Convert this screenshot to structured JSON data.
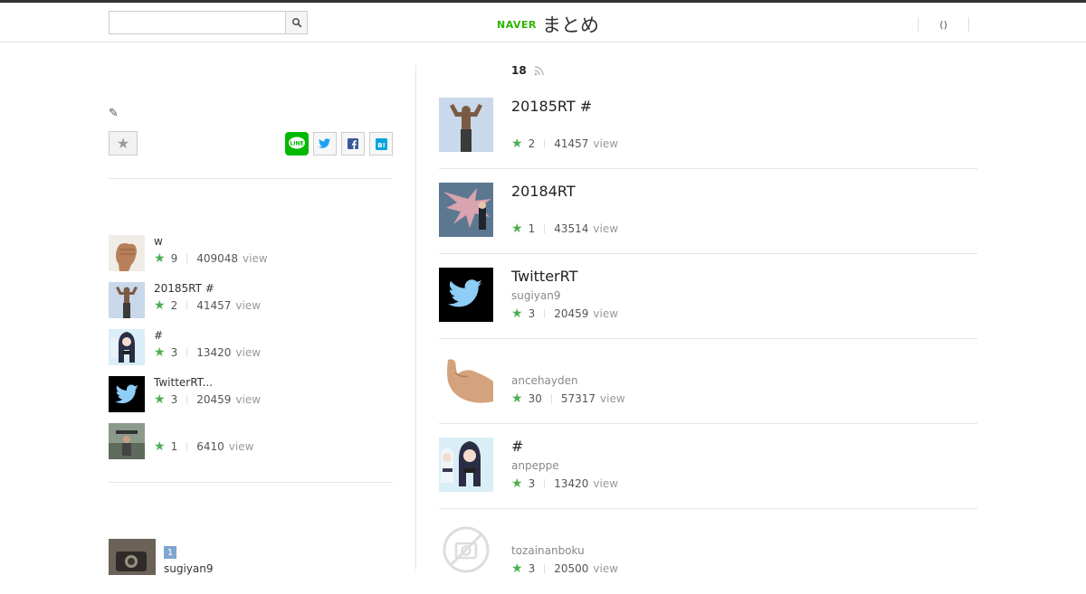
{
  "header": {
    "search": {
      "placeholder": ""
    },
    "logo": {
      "brand": "NAVER",
      "service": "まとめ"
    },
    "right_label": "()"
  },
  "left": {
    "edit_icon": "pencil-icon",
    "favorite_icon": "star-icon",
    "share": {
      "line_label": "LINE",
      "twitter_icon": "twitter-icon",
      "facebook_icon": "facebook-icon",
      "hatena_label": "B!"
    },
    "popular": [
      {
        "title": "w",
        "stars": "9",
        "views": "409048",
        "view_label": "view"
      },
      {
        "title": "20185RT #",
        "stars": "2",
        "views": "41457",
        "view_label": "view"
      },
      {
        "title": "#",
        "stars": "3",
        "views": "13420",
        "view_label": "view"
      },
      {
        "title": "TwitterRT...",
        "stars": "3",
        "views": "20459",
        "view_label": "view"
      },
      {
        "title": "",
        "stars": "1",
        "views": "6410",
        "view_label": "view"
      }
    ],
    "author": {
      "rank": "1",
      "name": "sugiyan9"
    }
  },
  "main": {
    "count": "18",
    "rss_icon": "rss-icon",
    "items": [
      {
        "title": "20185RT #",
        "author": "",
        "stars": "2",
        "views": "41457",
        "view_label": "view"
      },
      {
        "title": "20184RT",
        "author": "",
        "stars": "1",
        "views": "43514",
        "view_label": "view"
      },
      {
        "title": "TwitterRT",
        "author": "sugiyan9",
        "stars": "3",
        "views": "20459",
        "view_label": "view"
      },
      {
        "title": "",
        "author": "ancehayden",
        "stars": "30",
        "views": "57317",
        "view_label": "view"
      },
      {
        "title": "#",
        "author": "anpeppe",
        "stars": "3",
        "views": "13420",
        "view_label": "view"
      },
      {
        "title": "",
        "author": "tozainanboku",
        "stars": "3",
        "views": "20500",
        "view_label": "view"
      }
    ]
  },
  "colors": {
    "star": "#4caf50",
    "naver_green": "#2db400",
    "twitter_blue": "#1da1f2"
  }
}
